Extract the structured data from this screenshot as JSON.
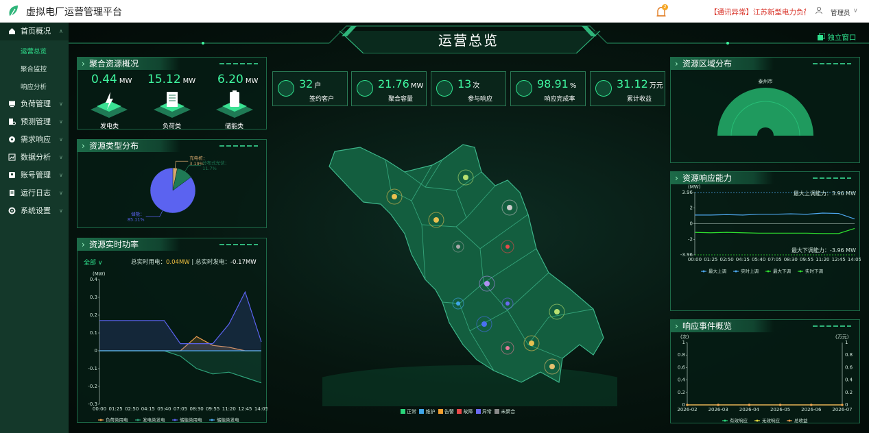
{
  "app": {
    "title": "虚拟电厂运营管理平台"
  },
  "topbar": {
    "badge_count": "2",
    "alarm_text": "【通讯异常】江苏新型电力负荷",
    "user": "管理员",
    "caret": "∨"
  },
  "sidebar": {
    "items": [
      {
        "label": "首页概况",
        "icon": "home-icon",
        "active": true,
        "chevron": "∧"
      },
      {
        "label": "负荷管理",
        "icon": "monitor-icon",
        "chevron": "∨"
      },
      {
        "label": "预测管理",
        "icon": "forecast-icon",
        "chevron": "∨"
      },
      {
        "label": "需求响应",
        "icon": "response-icon",
        "chevron": "∨"
      },
      {
        "label": "数据分析",
        "icon": "analysis-icon",
        "chevron": "∨"
      },
      {
        "label": "账号管理",
        "icon": "account-icon",
        "chevron": "∨"
      },
      {
        "label": "运行日志",
        "icon": "log-icon",
        "chevron": "∨"
      },
      {
        "label": "系统设置",
        "icon": "gear-icon",
        "chevron": "∨"
      }
    ],
    "subitems": [
      {
        "label": "运营总览",
        "active": true
      },
      {
        "label": "聚合监控"
      },
      {
        "label": "响应分析"
      }
    ]
  },
  "header": {
    "title": "运营总览",
    "standalone": "独立窗口"
  },
  "aggregate": {
    "title": "聚合资源概况",
    "items": [
      {
        "value": "0.44",
        "unit": "MW",
        "label": "发电类"
      },
      {
        "value": "15.12",
        "unit": "MW",
        "label": "负荷类"
      },
      {
        "value": "6.20",
        "unit": "MW",
        "label": "储能类"
      }
    ]
  },
  "types": {
    "title": "资源类型分布",
    "chart_data": {
      "type": "pie",
      "slices": [
        {
          "name": "充电桩",
          "value": 3.19,
          "label": "充电桩：",
          "pct": "3.19%",
          "color": "#d7a86e"
        },
        {
          "name": "分布式光伏",
          "value": 11.7,
          "label": "分布式光伏：",
          "pct": "11.7%",
          "color": "#1f7a55"
        },
        {
          "name": "储能",
          "value": 85.11,
          "label": "储能：",
          "pct": "85.11%",
          "color": "#5b63f0"
        }
      ]
    }
  },
  "realtime": {
    "title": "资源实时功率",
    "filter": "全部 ∨",
    "summary": {
      "use_label": "总实时用电：",
      "use_value": "0.04MW",
      "sep": " | ",
      "gen_label": "总实时发电：",
      "gen_value": "-0.17MW"
    },
    "chart_data": {
      "type": "line",
      "ylabel": "(MW)",
      "ylim": [
        -0.3,
        0.4
      ],
      "yticks": [
        "0.4",
        "0.3",
        "0.2",
        "0.1",
        "0",
        "-0.1",
        "-0.2",
        "-0.3"
      ],
      "x": [
        "00:00",
        "01:25",
        "02:50",
        "04:15",
        "05:40",
        "07:05",
        "08:30",
        "09:55",
        "11:20",
        "12:45",
        "14:05"
      ],
      "series": [
        {
          "name": "负荷类用电",
          "color": "#f0a050",
          "values": [
            0,
            0,
            0,
            0,
            0,
            0,
            0.08,
            0.03,
            0.02,
            0,
            0
          ]
        },
        {
          "name": "发电类发电",
          "color": "#2ea27a",
          "values": [
            0,
            0,
            0,
            0,
            0,
            -0.03,
            -0.1,
            -0.13,
            -0.12,
            -0.15,
            -0.18
          ]
        },
        {
          "name": "储能类用电",
          "color": "#5b63f0",
          "values": [
            0.17,
            0.17,
            0.17,
            0.17,
            0.17,
            0.04,
            0.04,
            0.04,
            0.15,
            0.33,
            0.05
          ]
        },
        {
          "name": "储能类发电",
          "color": "#4ea8f0",
          "values": [
            0,
            0,
            0,
            0,
            0,
            0,
            0,
            0,
            0,
            0,
            0
          ]
        }
      ]
    }
  },
  "stats": [
    {
      "value": "32",
      "unit": "户",
      "label": "签约客户"
    },
    {
      "value": "21.76",
      "unit": "MW",
      "label": "聚合容量"
    },
    {
      "value": "13",
      "unit": "次",
      "label": "参与响应"
    },
    {
      "value": "98.91",
      "unit": "%",
      "label": "响应完成率"
    },
    {
      "value": "31.12",
      "unit": "万元",
      "label": "累计收益"
    }
  ],
  "map": {
    "legend": [
      {
        "label": "正常",
        "color": "#2ad67a"
      },
      {
        "label": "维护",
        "color": "#3fa6e8"
      },
      {
        "label": "告警",
        "color": "#f0a030"
      },
      {
        "label": "故障",
        "color": "#e84a4a"
      },
      {
        "label": "异常",
        "color": "#6a6af0"
      },
      {
        "label": "未聚合",
        "color": "#8a8a8a"
      }
    ]
  },
  "region": {
    "title": "资源区域分布",
    "chart_data": {
      "type": "pie",
      "slices": [
        {
          "name": "泰州市",
          "value": 100,
          "color": "#1f9a5e"
        }
      ]
    }
  },
  "capacity": {
    "title": "资源响应能力",
    "chart_data": {
      "type": "line",
      "ylabel": "(MW)",
      "ylim": [
        -3.96,
        3.96
      ],
      "yticks": [
        "3.96",
        "2",
        "0",
        "-2",
        "-3.96"
      ],
      "x": [
        "00:00",
        "01:25",
        "02:50",
        "04:15",
        "05:40",
        "07:05",
        "08:30",
        "09:55",
        "11:20",
        "12:45",
        "14:05"
      ],
      "annotations": [
        "最大上调能力：3.96 MW",
        "最大下调能力：-3.96 MW"
      ],
      "series": [
        {
          "name": "最大上调",
          "color": "#4ea8f0",
          "values": [
            3.96,
            3.96,
            3.96,
            3.96,
            3.96,
            3.96,
            3.96,
            3.96,
            3.96,
            3.96,
            3.96
          ]
        },
        {
          "name": "实时上调",
          "color": "#4ea8f0",
          "values": [
            1.1,
            1.1,
            1.15,
            1.1,
            1.2,
            1.2,
            1.25,
            1.2,
            1.35,
            1.3,
            0.6
          ]
        },
        {
          "name": "最大下调",
          "color": "#2fe22f",
          "values": [
            -3.96,
            -3.96,
            -3.96,
            -3.96,
            -3.96,
            -3.96,
            -3.96,
            -3.96,
            -3.96,
            -3.96,
            -3.96
          ]
        },
        {
          "name": "实时下调",
          "color": "#2fe22f",
          "values": [
            -1.1,
            -1.15,
            -1.1,
            -1.15,
            -1.2,
            -1.2,
            -1.2,
            -1.2,
            -1.25,
            -1.25,
            -0.6
          ]
        }
      ]
    }
  },
  "events": {
    "title": "响应事件概览",
    "chart_data": {
      "type": "line",
      "ylabel_left": "(次)",
      "ylabel_right": "(万元)",
      "ylim": [
        0,
        1
      ],
      "yticks": [
        "1",
        "0.8",
        "0.6",
        "0.4",
        "0.2",
        "0"
      ],
      "x": [
        "2026-02",
        "2026-03",
        "2026-04",
        "2026-05",
        "2026-06",
        "2026-07"
      ],
      "series": [
        {
          "name": "有效响应",
          "color": "#2ad67a",
          "values": [
            0,
            0,
            0,
            0,
            0,
            0
          ]
        },
        {
          "name": "无效响应",
          "color": "#e8e040",
          "values": [
            0,
            0,
            0,
            0,
            0,
            0
          ]
        },
        {
          "name": "总收益",
          "color": "#f0a050",
          "values": [
            0,
            0,
            0,
            0,
            0,
            0
          ]
        }
      ]
    }
  }
}
